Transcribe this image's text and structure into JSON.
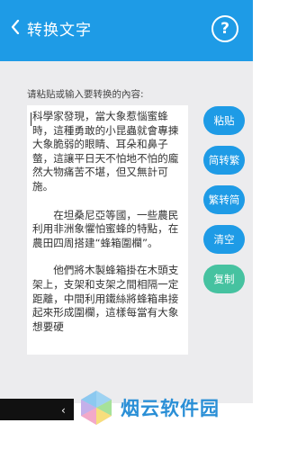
{
  "header": {
    "title": "转换文字",
    "help_symbol": "?"
  },
  "main": {
    "prompt": "请粘贴或输入要转换的內容:",
    "paragraphs": [
      "科學家發現，當大象惹惱蜜蜂時，這種勇敢的小昆蟲就會專揀大象脆弱的眼睛、耳朵和鼻子螫，這讓平日天不怕地不怕的龐然大物痛苦不堪，但又無計可施。",
      "　　在坦桑尼亞等國，一些農民利用非洲象懼怕蜜蜂的特點，在農田四周搭建“蜂箱圍欄”。",
      "　　他們將木製蜂箱掛在木頭支架上，支架和支架之間相隔一定距離，中間利用鐵絲將蜂箱串接起來形成圍欄，這樣每當有大象想要硬"
    ]
  },
  "buttons": [
    {
      "label": "粘贴",
      "color": "#1e9be6"
    },
    {
      "label": "简转繁",
      "color": "#1e9be6"
    },
    {
      "label": "繁转简",
      "color": "#1e9be6"
    },
    {
      "label": "清空",
      "color": "#1e9be6"
    },
    {
      "label": "复制",
      "color": "#46c2a0"
    }
  ],
  "watermark": {
    "text": "烟云软件园"
  },
  "colors": {
    "primary": "#1e9be6",
    "accent_green": "#46c2a0",
    "background": "#ececee"
  }
}
